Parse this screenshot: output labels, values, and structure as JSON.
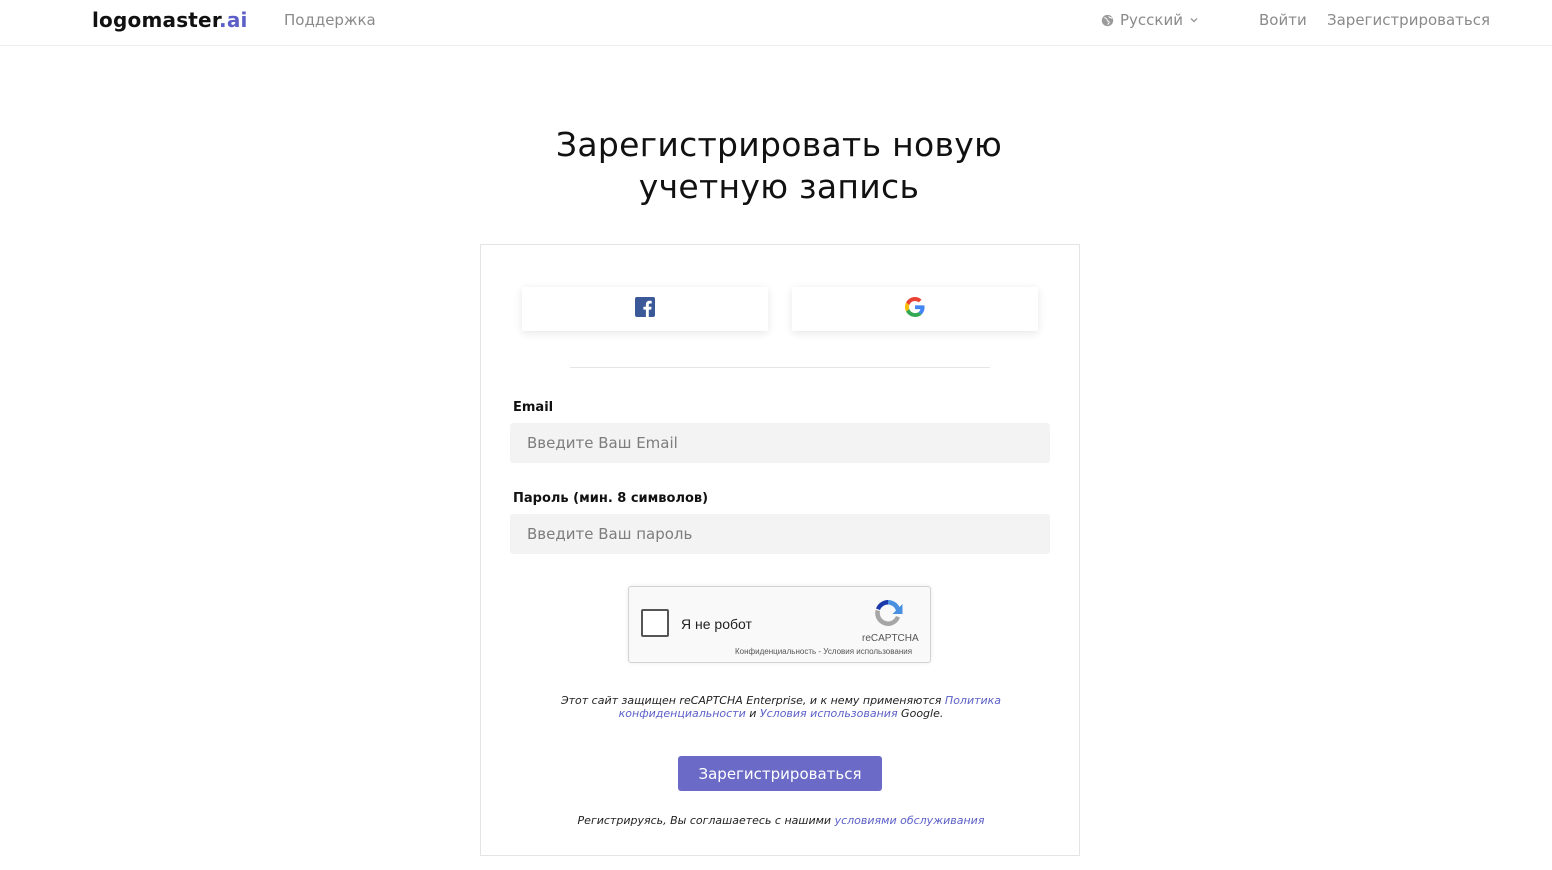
{
  "header": {
    "logo_main": "logomaster",
    "logo_accent": ".ai",
    "support": "Поддержка",
    "language": "Русский",
    "login": "Войти",
    "register": "Зарегистрироваться"
  },
  "page": {
    "title": "Зарегистрировать новую учетную запись"
  },
  "social": {
    "facebook_icon": "facebook-icon",
    "google_icon": "google-icon"
  },
  "form": {
    "email_label": "Email",
    "email_placeholder": "Введите Ваш Email",
    "email_value": "",
    "password_label": "Пароль (мин. 8 символов)",
    "password_placeholder": "Введите Ваш пароль",
    "password_value": ""
  },
  "recaptcha": {
    "label": "Я не робот",
    "brand": "reCAPTCHA",
    "privacy": "Конфиденциальность",
    "separator": " - ",
    "terms": "Условия использования"
  },
  "protect_note": {
    "prefix": "Этот сайт защищен reCAPTCHA Enterprise, и к нему применяются ",
    "privacy_link": "Политика конфиденциальности",
    "and": " и ",
    "terms_link": "Условия использования",
    "suffix": " Google."
  },
  "submit_label": "Зарегистрироваться",
  "terms_note": {
    "prefix": "Регистрируясь, Вы соглашаетесь с нашими ",
    "link": "условиями обслуживания"
  },
  "colors": {
    "accent": "#5b5fc7",
    "button": "#6b6bc7",
    "facebook": "#3b5998"
  }
}
